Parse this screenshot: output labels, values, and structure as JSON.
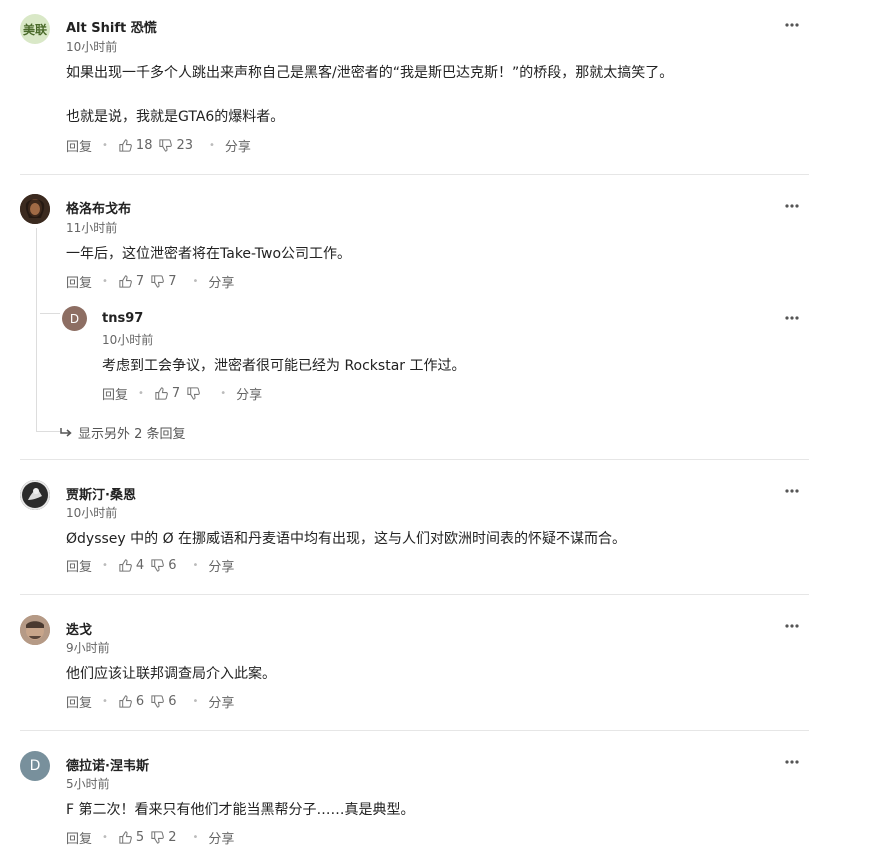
{
  "comments": [
    {
      "author": "Alt Shift 恐慌",
      "time": "10小时前",
      "avatar_text": "美联",
      "avatar_color": "#d9e8c7",
      "avatar_text_color": "#4a6a2a",
      "lines": [
        "如果出现一千多个人跳出来声称自己是黑客/泄密者的“我是斯巴达克斯！”的桥段，那就太搞笑了。",
        "也就是说，我就是GTA6的爆料者。"
      ],
      "reply_label": "回复",
      "likes": "18",
      "dislikes": "23",
      "share_label": "分享"
    },
    {
      "author": "格洛布戈布",
      "time": "11小时前",
      "avatar_text": "",
      "avatar_color": "#3b2a1f",
      "lines": [
        "一年后，这位泄密者将在Take-Two公司工作。"
      ],
      "reply_label": "回复",
      "likes": "7",
      "dislikes": "7",
      "share_label": "分享"
    },
    {
      "author": "tns97",
      "time": "10小时前",
      "avatar_text": "D",
      "avatar_color": "#8d6e63",
      "lines": [
        "考虑到工会争议，泄密者很可能已经为 Rockstar 工作过。"
      ],
      "reply_label": "回复",
      "likes": "7",
      "dislikes": "",
      "share_label": "分享"
    },
    {
      "author": "贾斯汀·桑恩",
      "time": "10小时前",
      "avatar_text": "",
      "avatar_color": "#2b2b2b",
      "lines": [
        "Ødyssey 中的 Ø 在挪威语和丹麦语中均有出现，这与人们对欧洲时间表的怀疑不谋而合。"
      ],
      "reply_label": "回复",
      "likes": "4",
      "dislikes": "6",
      "share_label": "分享"
    },
    {
      "author": "迭戈",
      "time": "9小时前",
      "avatar_text": "",
      "avatar_color": "#a8856b",
      "lines": [
        "他们应该让联邦调查局介入此案。"
      ],
      "reply_label": "回复",
      "likes": "6",
      "dislikes": "6",
      "share_label": "分享"
    },
    {
      "author": "德拉诺·涅韦斯",
      "time": "5小时前",
      "avatar_text": "D",
      "avatar_color": "#78909c",
      "lines": [
        "F 第二次！看来只有他们才能当黑帮分子……真是典型。"
      ],
      "reply_label": "回复",
      "likes": "5",
      "dislikes": "2",
      "share_label": "分享"
    }
  ],
  "show_more_replies": "显示另外 2 条回复",
  "icons": {
    "more": "more-dots-icon",
    "like": "thumbs-up-icon",
    "dislike": "thumbs-down-icon",
    "reply_arrow": "reply-arrow-icon"
  }
}
